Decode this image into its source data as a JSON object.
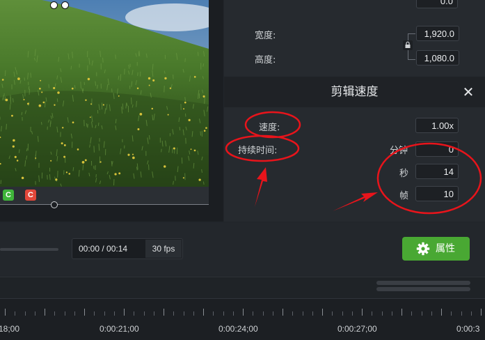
{
  "properties": {
    "z_value": "0.0",
    "width_label": "宽度:",
    "width_value": "1,920.0",
    "height_label": "高度:",
    "height_value": "1,080.0",
    "lock_icon": "lock-icon"
  },
  "clip_speed": {
    "title": "剪辑速度",
    "close_glyph": "✕",
    "speed_label": "速度:",
    "speed_value": "1.00x",
    "duration_label": "持续时间:",
    "minutes_label": "分钟",
    "minutes_value": "0",
    "seconds_label": "秒",
    "seconds_value": "14",
    "frames_label": "帧",
    "frames_value": "10"
  },
  "playback": {
    "time": "00:00 / 00:14",
    "fps": "30 fps",
    "properties_button": "属性"
  },
  "timeline": {
    "labels": [
      "18;00",
      "0:00:21;00",
      "0:00:24;00",
      "0:00:27;00",
      "0:00:3"
    ]
  },
  "thumb_chips": [
    "C",
    "C"
  ],
  "colors": {
    "accent_green": "#49a833",
    "annotation_red": "#e8141b",
    "chip_green": "#3fb43a",
    "chip_red": "#e2473a"
  }
}
